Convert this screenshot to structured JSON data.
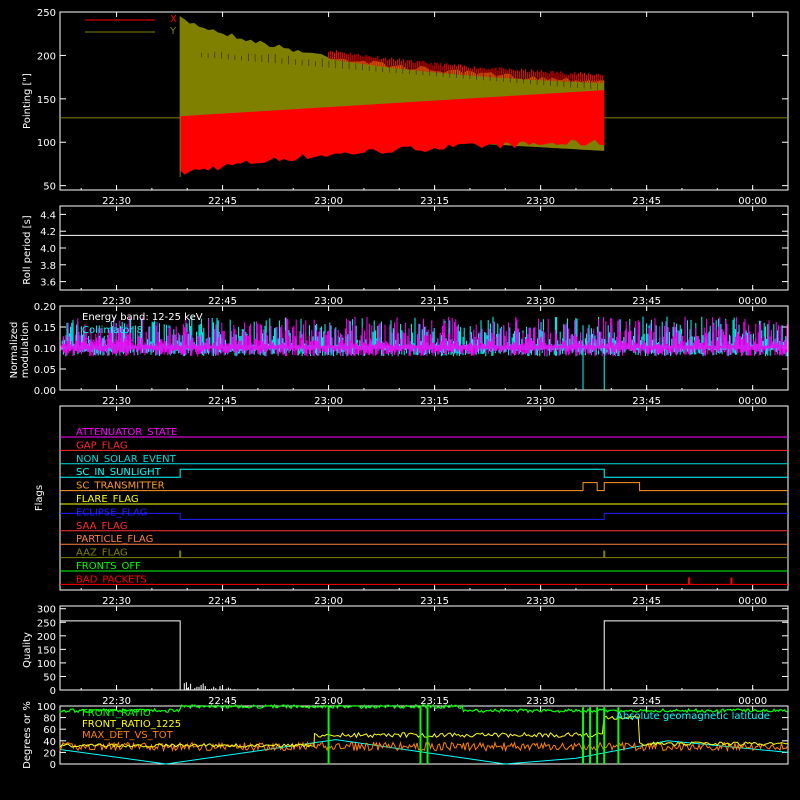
{
  "x_ticks": [
    "22:30",
    "22:45",
    "23:00",
    "23:15",
    "23:30",
    "23:45",
    "00:00"
  ],
  "chart_data": [
    {
      "type": "line",
      "ylabel": "Pointing [\"]",
      "ylim": [
        45,
        250
      ],
      "y_ticks": [
        50,
        100,
        150,
        200,
        250
      ],
      "legend": "top-left",
      "series": [
        {
          "name": "X",
          "color": "#ff0000",
          "note_values": {
            "center_before": 128,
            "envelope_start": [
              60,
              245
            ],
            "envelope_end": [
              100,
              160
            ]
          }
        },
        {
          "name": "Y",
          "color": "#808000",
          "note_values": {
            "center_before": 128,
            "envelope_start": [
              85,
              245
            ],
            "envelope_end": [
              90,
              165
            ]
          }
        }
      ],
      "data_window": [
        "22:39",
        "23:39"
      ]
    },
    {
      "type": "line",
      "ylabel": "Roll period [s]",
      "ylim": [
        3.5,
        4.5
      ],
      "y_ticks": [
        3.6,
        3.8,
        4.0,
        4.2,
        4.4
      ],
      "series": [
        {
          "values_constant": 4.15,
          "color": "#ffffff"
        }
      ]
    },
    {
      "type": "line",
      "ylabel": "Normalized modulation",
      "ylim": [
        0.0,
        0.2
      ],
      "y_ticks": [
        "0.00",
        "0.05",
        "0.10",
        "0.15",
        "0.20"
      ],
      "annotations": [
        "Energy band: 12-25 keV",
        "Collimator 8",
        "Collimator 9"
      ],
      "series": [
        {
          "name": "Collimator 8",
          "color": "#00ffff",
          "baseline": 0.1
        },
        {
          "name": "Collimator 9",
          "color": "#ff00ff",
          "baseline": 0.1
        }
      ]
    },
    {
      "type": "line",
      "ylabel": "Flags",
      "flags": [
        {
          "name": "ATTENUATOR_STATE",
          "color": "#ff00ff"
        },
        {
          "name": "GAP_FLAG",
          "color": "#ff2a2a"
        },
        {
          "name": "NON_SOLAR_EVENT",
          "color": "#00dddd"
        },
        {
          "name": "SC_IN_SUNLIGHT",
          "color": "#00ffff",
          "high": [
            [
              "22:39",
              "23:39"
            ]
          ]
        },
        {
          "name": "SC_TRANSMITTER",
          "color": "#ff9a20",
          "high": [
            [
              "23:36",
              "23:38"
            ],
            [
              "23:39",
              "23:44"
            ]
          ]
        },
        {
          "name": "FLARE_FLAG",
          "color": "#ffff00"
        },
        {
          "name": "ECLIPSE_FLAG",
          "color": "#2020ff",
          "low": [
            [
              "22:39",
              "23:39"
            ]
          ]
        },
        {
          "name": "SAA_FLAG",
          "color": "#ff3030"
        },
        {
          "name": "PARTICLE_FLAG",
          "color": "#ff8040"
        },
        {
          "name": "AAZ_FLAG",
          "color": "#808000",
          "spikes": [
            "22:39",
            "23:39"
          ]
        },
        {
          "name": "FRONTS_OFF",
          "color": "#00ff00"
        },
        {
          "name": "BAD_PACKETS",
          "color": "#ff0000",
          "spikes": [
            "23:51",
            "23:57"
          ]
        }
      ]
    },
    {
      "type": "line",
      "ylabel": "Quality",
      "ylim": [
        0,
        310
      ],
      "y_ticks": [
        0,
        50,
        100,
        150,
        200,
        250,
        300
      ],
      "series": [
        {
          "color": "#ffffff",
          "before": 255,
          "after": 255,
          "data_window": [
            "22:39",
            "23:39"
          ]
        }
      ]
    },
    {
      "type": "line",
      "ylabel": "Degrees or %",
      "ylim": [
        0,
        100
      ],
      "y_ticks": [
        0,
        20,
        40,
        60,
        80,
        100
      ],
      "series": [
        {
          "name": "FRONT_RATIO",
          "color": "#00ff00",
          "level": 92
        },
        {
          "name": "FRONT_RATIO_1225",
          "color": "#ffff00",
          "level": 50
        },
        {
          "name": "MAX_DET_VS_TOT",
          "color": "#ff8000",
          "level": 30
        },
        {
          "name": "Absolute geomagnetic latitude",
          "color": "#00ffff"
        }
      ]
    }
  ]
}
